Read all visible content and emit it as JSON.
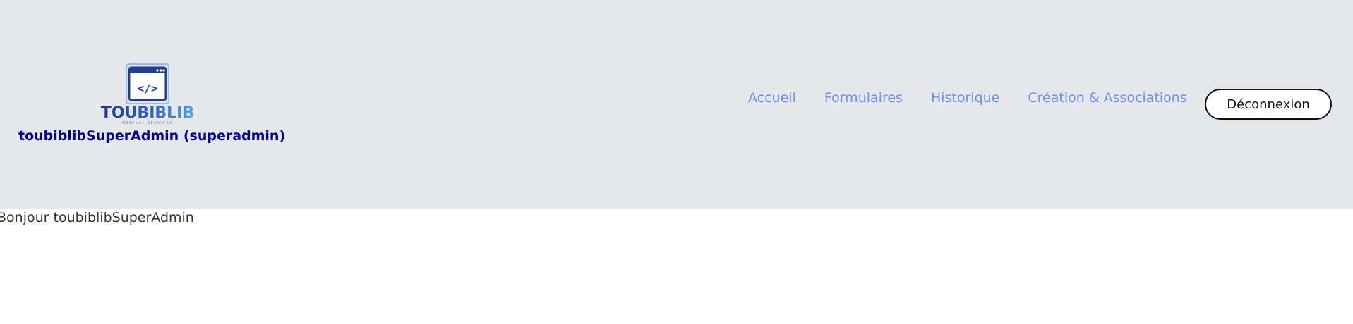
{
  "header": {
    "logo": {
      "brand_text": "TOUBIBLIB",
      "tagline": "MEDICAL SERVICES",
      "icon": "code-window-icon",
      "code_glyph": "</>"
    },
    "user_line": "toubiblibSuperAdmin (superadmin)",
    "nav": {
      "items": [
        {
          "label": "Accueil"
        },
        {
          "label": "Formulaires"
        },
        {
          "label": "Historique"
        },
        {
          "label": "Création & Associations"
        }
      ]
    },
    "logout_label": "Déconnexion"
  },
  "main": {
    "greeting": "Bonjour toubiblibSuperAdmin"
  },
  "colors": {
    "header_bg": "#e5e7eb",
    "nav_link": "#6b8ff0",
    "user_line": "#00008b",
    "brand_dark": "#1e3a8a",
    "brand_light": "#4aa3e8"
  }
}
